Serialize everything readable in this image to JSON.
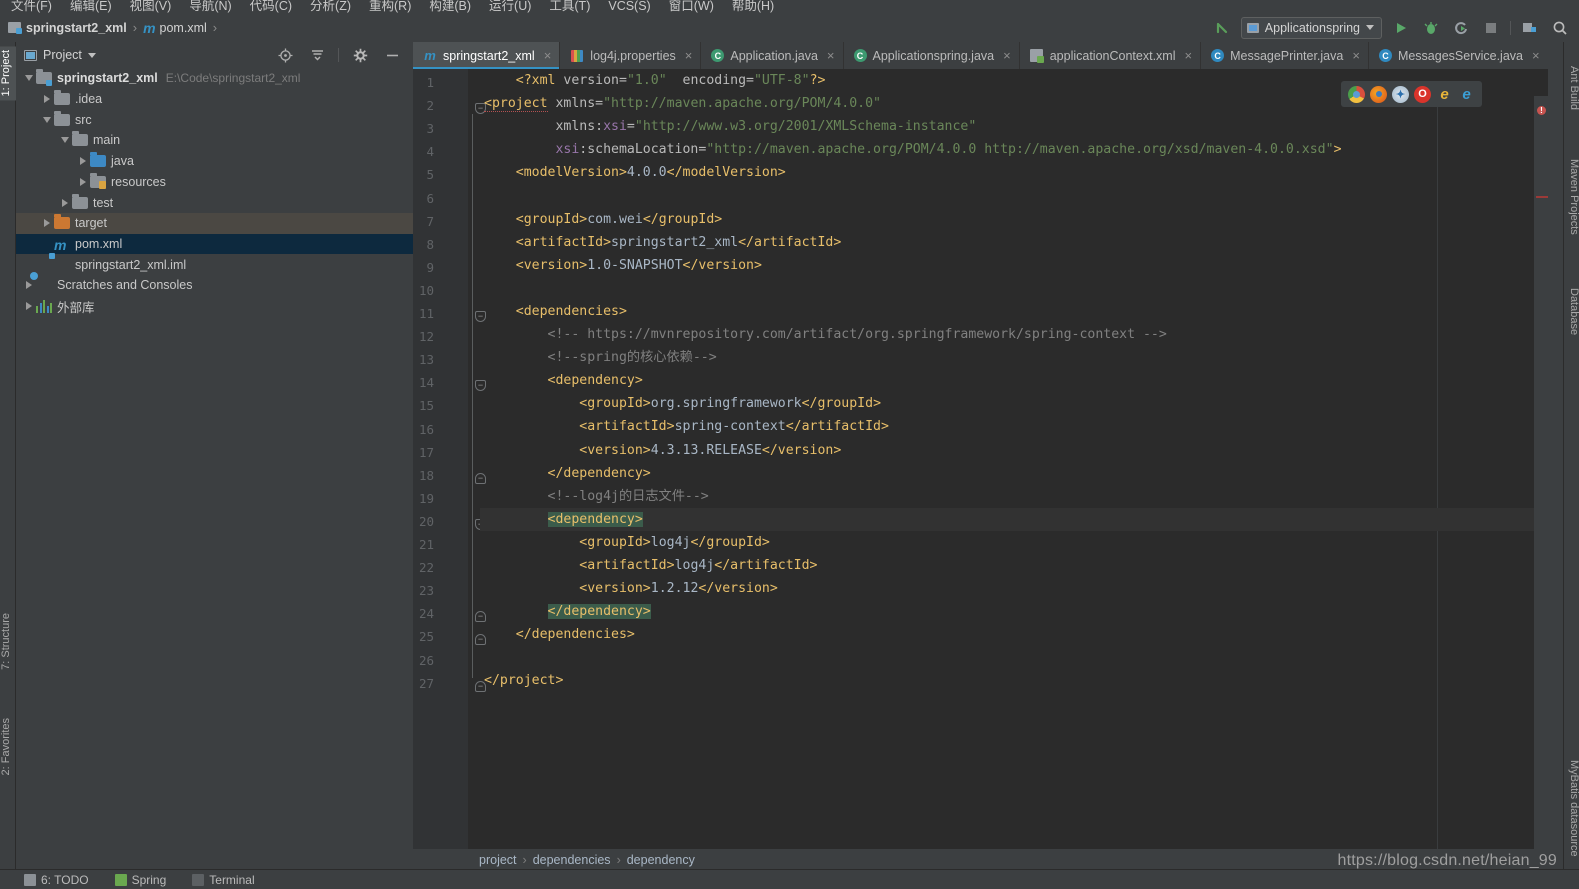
{
  "menubar": {
    "items": [
      "文件(F)",
      "编辑(E)",
      "视图(V)",
      "导航(N)",
      "代码(C)",
      "分析(Z)",
      "重构(R)",
      "构建(B)",
      "运行(U)",
      "工具(T)",
      "VCS(S)",
      "窗口(W)",
      "帮助(H)"
    ]
  },
  "navbar": {
    "crumb_project": "springstart2_xml",
    "crumb_file": "pom.xml",
    "run_config": "Applicationspring",
    "icons": [
      "back-arrow-icon",
      "run-icon",
      "debug-icon",
      "run-with-coverage-icon",
      "stop-icon",
      "project-structure-icon",
      "search-everywhere-icon"
    ]
  },
  "left_tool_strip": {
    "top": [
      "1: Project"
    ],
    "bottom": [
      "7: Structure",
      "2: Favorites"
    ]
  },
  "right_tool_strip": {
    "top": [
      "Ant Build",
      "Maven Projects",
      "Database"
    ],
    "bottom": [
      "MyBatis datasource"
    ]
  },
  "project_panel": {
    "title": "Project",
    "tools": [
      "locate-icon",
      "collapse-all-icon",
      "settings-icon",
      "hide-icon"
    ],
    "tree": [
      {
        "label": "springstart2_xml",
        "path": "E:\\Code\\springstart2_xml",
        "icon": "module-folder-icon",
        "arrow": "down",
        "indent": 0,
        "bold": true,
        "state": "none"
      },
      {
        "label": ".idea",
        "path": "",
        "icon": "folder-icon",
        "arrow": "right",
        "indent": 1,
        "bold": false,
        "state": "none"
      },
      {
        "label": "src",
        "path": "",
        "icon": "folder-icon",
        "arrow": "down",
        "indent": 1,
        "bold": false,
        "state": "none"
      },
      {
        "label": "main",
        "path": "",
        "icon": "folder-icon",
        "arrow": "down",
        "indent": 2,
        "bold": false,
        "state": "none"
      },
      {
        "label": "java",
        "path": "",
        "icon": "source-folder-icon",
        "arrow": "right",
        "indent": 3,
        "bold": false,
        "state": "none"
      },
      {
        "label": "resources",
        "path": "",
        "icon": "resources-folder-icon",
        "arrow": "right",
        "indent": 3,
        "bold": false,
        "state": "none"
      },
      {
        "label": "test",
        "path": "",
        "icon": "folder-icon",
        "arrow": "right",
        "indent": 2,
        "bold": false,
        "state": "none"
      },
      {
        "label": "target",
        "path": "",
        "icon": "excluded-folder-icon",
        "arrow": "right",
        "indent": 1,
        "bold": false,
        "state": "hover"
      },
      {
        "label": "pom.xml",
        "path": "",
        "icon": "maven-pom-icon",
        "arrow": "none",
        "indent": 1,
        "bold": false,
        "state": "selected"
      },
      {
        "label": "springstart2_xml.iml",
        "path": "",
        "icon": "iml-icon",
        "arrow": "none",
        "indent": 1,
        "bold": false,
        "state": "none"
      },
      {
        "label": "Scratches and Consoles",
        "path": "",
        "icon": "scratches-icon",
        "arrow": "right",
        "indent": 0,
        "bold": false,
        "state": "none"
      },
      {
        "label": "外部库",
        "path": "",
        "icon": "external-libraries-icon",
        "arrow": "right",
        "indent": 0,
        "bold": false,
        "state": "none"
      }
    ]
  },
  "editor": {
    "tabs": [
      {
        "label": "springstart2_xml",
        "icon": "maven-icon",
        "active": true
      },
      {
        "label": "log4j.properties",
        "icon": "properties-icon",
        "active": false
      },
      {
        "label": "Application.java",
        "icon": "java-class-icon",
        "active": false
      },
      {
        "label": "Applicationspring.java",
        "icon": "java-class-icon",
        "active": false
      },
      {
        "label": "applicationContext.xml",
        "icon": "spring-context-icon",
        "active": false
      },
      {
        "label": "MessagePrinter.java",
        "icon": "class-icon",
        "active": false
      },
      {
        "label": "MessagesService.java",
        "icon": "class-icon",
        "active": false
      }
    ],
    "browsers": [
      "chrome-icon",
      "firefox-icon",
      "safari-icon",
      "opera-icon",
      "ie-icon",
      "edge-icon"
    ],
    "lines": [
      {
        "n": 1,
        "indent": 1,
        "tokens": [
          {
            "t": "tag",
            "v": "<?xml "
          },
          {
            "t": "attr",
            "v": "version="
          },
          {
            "t": "str",
            "v": "\"1.0\""
          },
          {
            "t": "attr",
            "v": "  encoding="
          },
          {
            "t": "str",
            "v": "\"UTF-8\""
          },
          {
            "t": "tag",
            "v": "?>"
          }
        ]
      },
      {
        "n": 2,
        "indent": 0,
        "fold": "open",
        "tokens": [
          {
            "t": "tag sq",
            "v": "<project"
          },
          {
            "t": "attr",
            "v": " xmlns="
          },
          {
            "t": "str",
            "v": "\"http://maven.apache.org/POM/4.0.0\""
          }
        ]
      },
      {
        "n": 3,
        "indent": 0,
        "tokens": [
          {
            "t": "attr",
            "v": "         xmlns:"
          },
          {
            "t": "ns",
            "v": "xsi"
          },
          {
            "t": "attr",
            "v": "="
          },
          {
            "t": "str",
            "v": "\"http://www.w3.org/2001/XMLSchema-instance\""
          }
        ]
      },
      {
        "n": 4,
        "indent": 0,
        "tokens": [
          {
            "t": "ns",
            "v": "         xsi"
          },
          {
            "t": "attr",
            "v": ":schemaLocation="
          },
          {
            "t": "str",
            "v": "\"http://maven.apache.org/POM/4.0.0 http://maven.apache.org/xsd/maven-4.0.0.xsd\""
          },
          {
            "t": "tag",
            "v": ">"
          }
        ]
      },
      {
        "n": 5,
        "indent": 1,
        "tokens": [
          {
            "t": "tag",
            "v": "<modelVersion>"
          },
          {
            "t": "txt",
            "v": "4.0.0"
          },
          {
            "t": "tag",
            "v": "</modelVersion>"
          }
        ]
      },
      {
        "n": 6,
        "indent": 0,
        "tokens": []
      },
      {
        "n": 7,
        "indent": 1,
        "tokens": [
          {
            "t": "tag",
            "v": "<groupId>"
          },
          {
            "t": "txt",
            "v": "com.wei"
          },
          {
            "t": "tag",
            "v": "</groupId>"
          }
        ]
      },
      {
        "n": 8,
        "indent": 1,
        "tokens": [
          {
            "t": "tag",
            "v": "<artifactId>"
          },
          {
            "t": "txt",
            "v": "springstart2_xml"
          },
          {
            "t": "tag",
            "v": "</artifactId>"
          }
        ]
      },
      {
        "n": 9,
        "indent": 1,
        "tokens": [
          {
            "t": "tag",
            "v": "<version>"
          },
          {
            "t": "txt",
            "v": "1.0-SNAPSHOT"
          },
          {
            "t": "tag",
            "v": "</version>"
          }
        ]
      },
      {
        "n": 10,
        "indent": 0,
        "tokens": []
      },
      {
        "n": 11,
        "indent": 1,
        "fold": "open",
        "tokens": [
          {
            "t": "tag",
            "v": "<dependencies>"
          }
        ]
      },
      {
        "n": 12,
        "indent": 2,
        "tokens": [
          {
            "t": "cmt",
            "v": "<!-- https://mvnrepository.com/artifact/org.springframework/spring-context -->"
          }
        ]
      },
      {
        "n": 13,
        "indent": 2,
        "tokens": [
          {
            "t": "cmt",
            "v": "<!--spring的核心依赖-->"
          }
        ]
      },
      {
        "n": 14,
        "indent": 2,
        "fold": "open",
        "tokens": [
          {
            "t": "tag",
            "v": "<dependency>"
          }
        ]
      },
      {
        "n": 15,
        "indent": 3,
        "tokens": [
          {
            "t": "tag",
            "v": "<groupId>"
          },
          {
            "t": "txt",
            "v": "org.springframework"
          },
          {
            "t": "tag",
            "v": "</groupId>"
          }
        ]
      },
      {
        "n": 16,
        "indent": 3,
        "tokens": [
          {
            "t": "tag",
            "v": "<artifactId>"
          },
          {
            "t": "txt",
            "v": "spring-context"
          },
          {
            "t": "tag",
            "v": "</artifactId>"
          }
        ]
      },
      {
        "n": 17,
        "indent": 3,
        "tokens": [
          {
            "t": "tag",
            "v": "<version>"
          },
          {
            "t": "txt",
            "v": "4.3.13.RELEASE"
          },
          {
            "t": "tag",
            "v": "</version>"
          }
        ]
      },
      {
        "n": 18,
        "indent": 2,
        "fold": "close",
        "tokens": [
          {
            "t": "tag",
            "v": "</dependency>"
          }
        ]
      },
      {
        "n": 19,
        "indent": 2,
        "tokens": [
          {
            "t": "cmt",
            "v": "<!--log4j的日志文件-->"
          }
        ]
      },
      {
        "n": 20,
        "indent": 2,
        "fold": "open",
        "bulb": true,
        "current": true,
        "tokens": [
          {
            "t": "tag hl",
            "v": "<dependency>"
          }
        ]
      },
      {
        "n": 21,
        "indent": 3,
        "tokens": [
          {
            "t": "tag",
            "v": "<groupId>"
          },
          {
            "t": "txt",
            "v": "log4j"
          },
          {
            "t": "tag",
            "v": "</groupId>"
          }
        ]
      },
      {
        "n": 22,
        "indent": 3,
        "tokens": [
          {
            "t": "tag",
            "v": "<artifactId>"
          },
          {
            "t": "txt",
            "v": "log4j"
          },
          {
            "t": "tag",
            "v": "</artifactId>"
          }
        ]
      },
      {
        "n": 23,
        "indent": 3,
        "tokens": [
          {
            "t": "tag",
            "v": "<version>"
          },
          {
            "t": "txt",
            "v": "1.2.12"
          },
          {
            "t": "tag",
            "v": "</version>"
          }
        ]
      },
      {
        "n": 24,
        "indent": 2,
        "fold": "close",
        "tokens": [
          {
            "t": "tag hl",
            "v": "</dependency>"
          }
        ]
      },
      {
        "n": 25,
        "indent": 1,
        "fold": "close",
        "tokens": [
          {
            "t": "tag",
            "v": "</dependencies>"
          }
        ]
      },
      {
        "n": 26,
        "indent": 0,
        "tokens": []
      },
      {
        "n": 27,
        "indent": 0,
        "fold": "close",
        "tokens": [
          {
            "t": "tag",
            "v": "</project>"
          }
        ]
      }
    ]
  },
  "status_breadcrumbs": [
    "project",
    "dependencies",
    "dependency"
  ],
  "bottom_bar": {
    "items": [
      {
        "label": "6: TODO",
        "icon": "todo-icon"
      },
      {
        "label": "Spring",
        "icon": "spring-icon"
      },
      {
        "label": "Terminal",
        "icon": "terminal-icon"
      }
    ]
  },
  "watermark": "https://blog.csdn.net/heian_99",
  "colors": {
    "accent": "#3592c4",
    "selection": "#0d293e",
    "tag": "#e8bf6a",
    "string": "#6a8759",
    "comment": "#808080",
    "namespace": "#9876aa",
    "match_highlight": "#3b5c4b",
    "editor_bg": "#2b2b2b",
    "panel_bg": "#3c3f41"
  }
}
